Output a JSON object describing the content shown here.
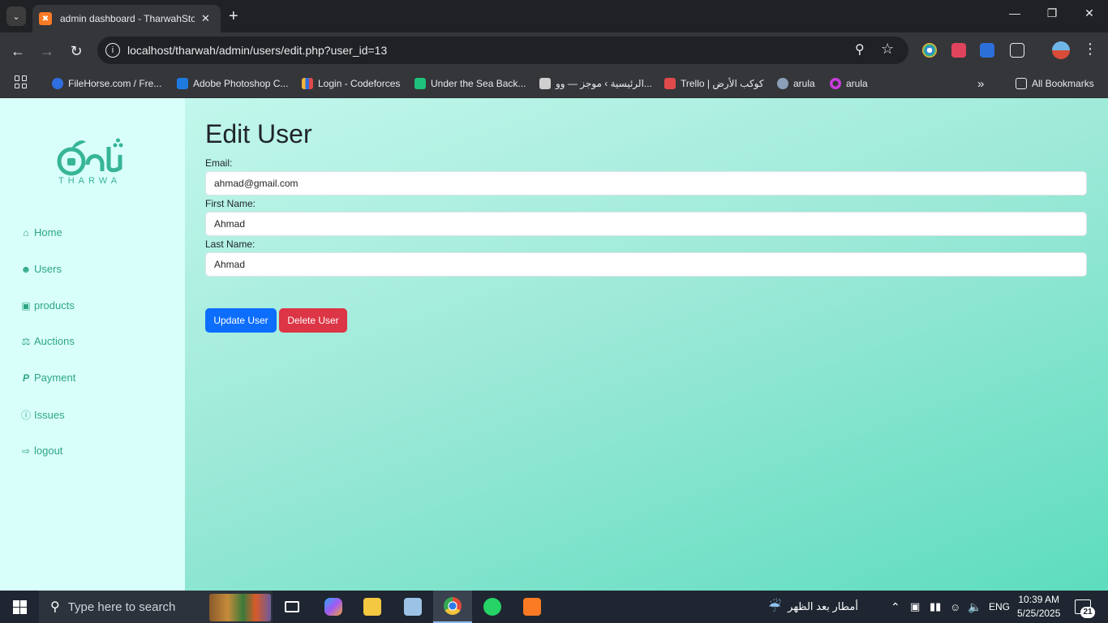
{
  "browser": {
    "tab_title": "admin dashboard - TharwahStore",
    "tab_favicon": "xampp-icon",
    "url": "localhost/tharwah/admin/users/edit.php?user_id=13",
    "bookmarks": [
      {
        "label": "FileHorse.com / Fre...",
        "color": "#2f6fe0"
      },
      {
        "label": "Adobe Photoshop C...",
        "color": "#1f7ae0"
      },
      {
        "label": "Login - Codeforces",
        "color": "#f2b43a"
      },
      {
        "label": "Under the Sea Back...",
        "color": "#1ec27a"
      },
      {
        "label": "الرئيسية › موجز — وو...",
        "color": "#cfcfcf"
      },
      {
        "label": "Trello | كوكب الأرض",
        "color": "#e04a4a"
      },
      {
        "label": "arula",
        "color": "#8aa0b8"
      },
      {
        "label": "arula",
        "color": "#c93ddc"
      }
    ],
    "all_bookmarks_label": "All Bookmarks"
  },
  "sidebar": {
    "logo_word": "THARWA",
    "items": [
      {
        "label": "Home",
        "icon": "home-icon"
      },
      {
        "label": "Users",
        "icon": "users-icon"
      },
      {
        "label": "products",
        "icon": "bag-icon"
      },
      {
        "label": "Auctions",
        "icon": "auction-icon"
      },
      {
        "label": "Payment",
        "icon": "paypal-icon"
      },
      {
        "label": "Issues",
        "icon": "question-circle-icon"
      },
      {
        "label": "logout",
        "icon": "logout-icon"
      }
    ]
  },
  "form": {
    "title": "Edit User",
    "email_label": "Email:",
    "email_value": "ahmad@gmail.com",
    "first_name_label": "First Name:",
    "first_name_value": "Ahmad",
    "last_name_label": "Last Name:",
    "last_name_value": "Ahmad",
    "update_button": "Update User",
    "delete_button": "Delete User"
  },
  "taskbar": {
    "search_placeholder": "Type here to search",
    "weather_text": "أمطار بعد الظهر",
    "language": "ENG",
    "time": "10:39 AM",
    "date": "5/25/2025",
    "notification_count": "21"
  },
  "colors": {
    "accent": "#2ca584",
    "update_button": "#0d6efd",
    "delete_button": "#dc3545",
    "sidebar_bg": "#d9fffb"
  }
}
